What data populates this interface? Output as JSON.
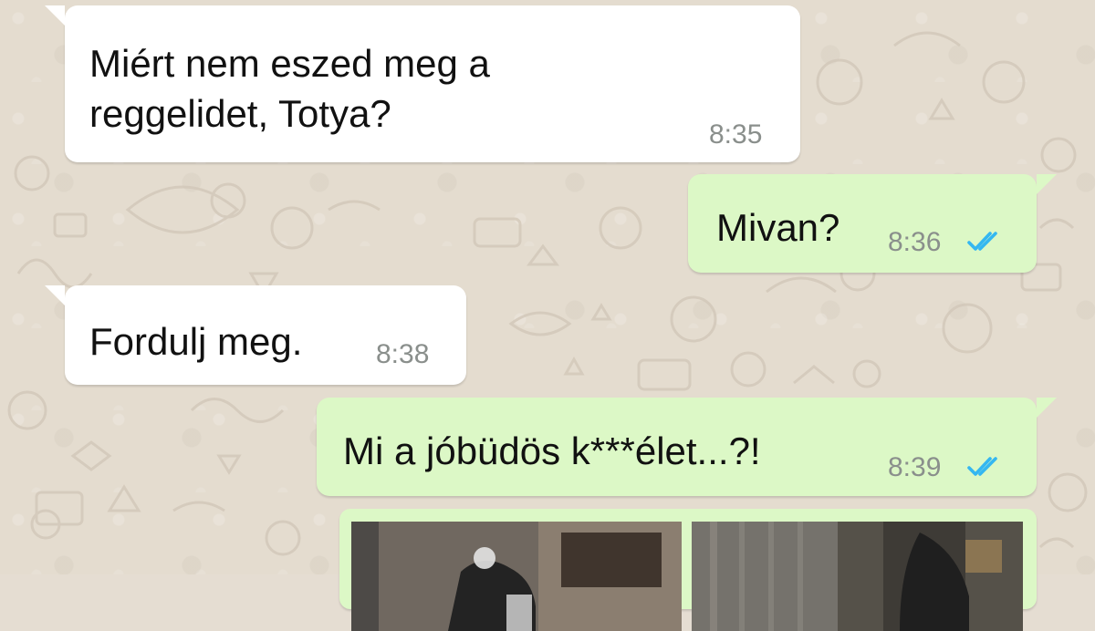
{
  "chat": {
    "messages": [
      {
        "direction": "incoming",
        "text": "Miért nem eszed meg a\nreggelidet, Totya?",
        "time": "8:35"
      },
      {
        "direction": "outgoing",
        "text": "Mivan?",
        "time": "8:36",
        "status": "read"
      },
      {
        "direction": "incoming",
        "text": "Fordulj meg.",
        "time": "8:38"
      },
      {
        "direction": "outgoing",
        "text": "Mi a jóbüdös k***élet...?!",
        "time": "8:39",
        "status": "read"
      },
      {
        "direction": "outgoing",
        "type": "image-album",
        "images": 2
      }
    ]
  },
  "colors": {
    "incoming_bubble": "#ffffff",
    "outgoing_bubble": "#dcf8c6",
    "read_ticks": "#34b7f1",
    "chat_wallpaper": "#e4dccf"
  },
  "icons": {
    "read_status": "double-check-icon"
  }
}
